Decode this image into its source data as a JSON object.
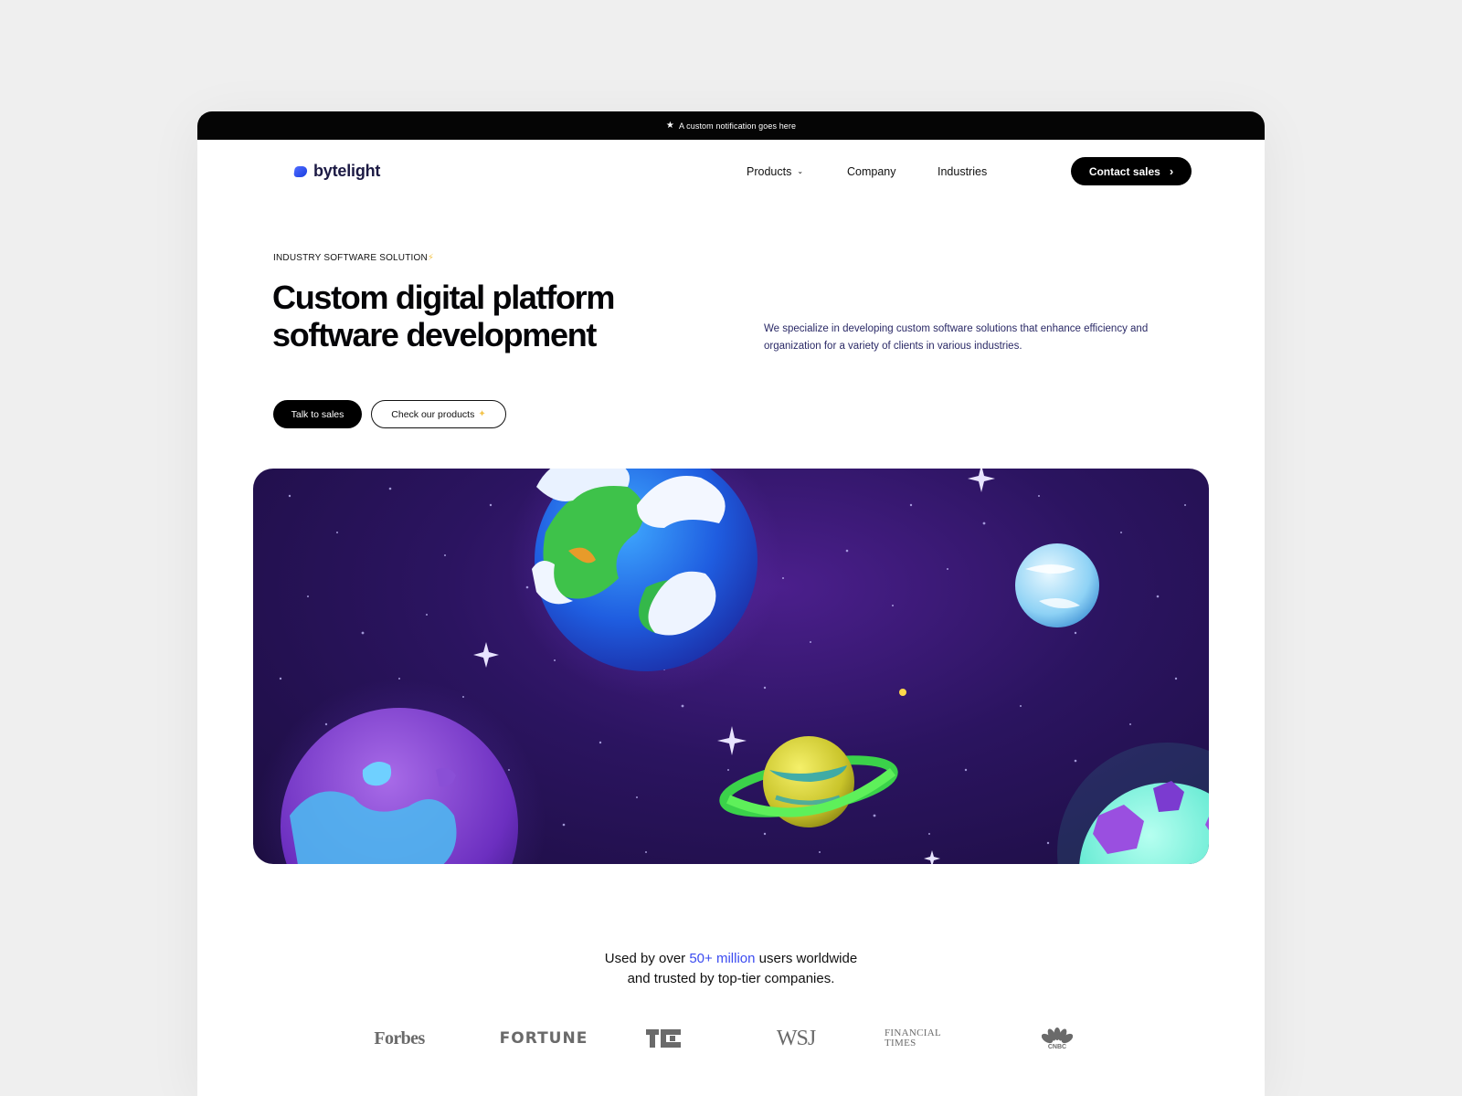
{
  "notification": {
    "icon": "star-icon",
    "text": "A custom notification goes here"
  },
  "brand": {
    "name": "bytelight",
    "accent": "#3b4bf0"
  },
  "nav": {
    "items": [
      {
        "label": "Products"
      },
      {
        "label": "Company"
      },
      {
        "label": "Industries"
      }
    ],
    "cta": "Contact sales"
  },
  "hero": {
    "eyebrow": "INDUSTRY SOFTWARE SOLUTION",
    "title_line1": "Custom digital platform",
    "title_line2": "software development",
    "description": "We specialize in developing custom software solutions that enhance efficiency and organization for a variety of clients in various industries.",
    "primary_button": "Talk to sales",
    "secondary_button": "Check our products"
  },
  "trust": {
    "prefix": "Used by over",
    "highlight": "50+ million",
    "suffix": "users worldwide",
    "line2": "and trusted by top-tier companies."
  },
  "press": {
    "forbes": "Forbes",
    "fortune": "FORTUNE",
    "wsj": "WSJ",
    "ft_line1": "FINANCIAL",
    "ft_line2": "TIMES",
    "cnbc": "CNBC"
  }
}
